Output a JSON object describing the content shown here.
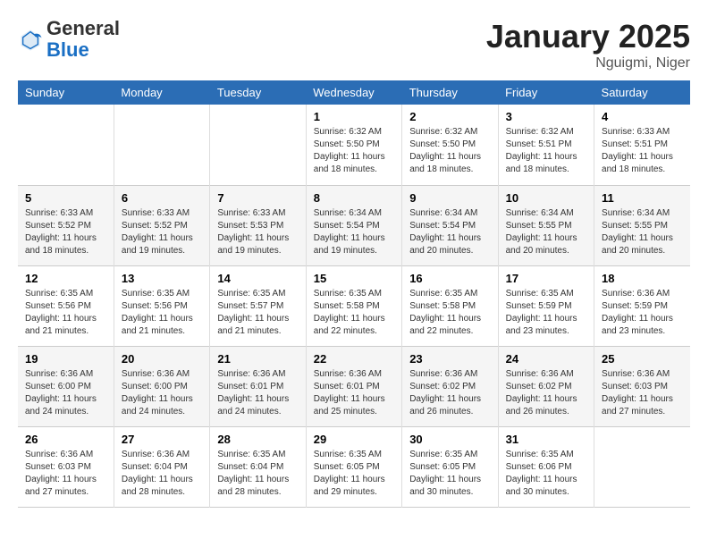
{
  "header": {
    "logo_general": "General",
    "logo_blue": "Blue",
    "month_year": "January 2025",
    "location": "Nguigmi, Niger"
  },
  "days_of_week": [
    "Sunday",
    "Monday",
    "Tuesday",
    "Wednesday",
    "Thursday",
    "Friday",
    "Saturday"
  ],
  "weeks": [
    [
      {
        "day": "",
        "info": ""
      },
      {
        "day": "",
        "info": ""
      },
      {
        "day": "",
        "info": ""
      },
      {
        "day": "1",
        "info": "Sunrise: 6:32 AM\nSunset: 5:50 PM\nDaylight: 11 hours\nand 18 minutes."
      },
      {
        "day": "2",
        "info": "Sunrise: 6:32 AM\nSunset: 5:50 PM\nDaylight: 11 hours\nand 18 minutes."
      },
      {
        "day": "3",
        "info": "Sunrise: 6:32 AM\nSunset: 5:51 PM\nDaylight: 11 hours\nand 18 minutes."
      },
      {
        "day": "4",
        "info": "Sunrise: 6:33 AM\nSunset: 5:51 PM\nDaylight: 11 hours\nand 18 minutes."
      }
    ],
    [
      {
        "day": "5",
        "info": "Sunrise: 6:33 AM\nSunset: 5:52 PM\nDaylight: 11 hours\nand 18 minutes."
      },
      {
        "day": "6",
        "info": "Sunrise: 6:33 AM\nSunset: 5:52 PM\nDaylight: 11 hours\nand 19 minutes."
      },
      {
        "day": "7",
        "info": "Sunrise: 6:33 AM\nSunset: 5:53 PM\nDaylight: 11 hours\nand 19 minutes."
      },
      {
        "day": "8",
        "info": "Sunrise: 6:34 AM\nSunset: 5:54 PM\nDaylight: 11 hours\nand 19 minutes."
      },
      {
        "day": "9",
        "info": "Sunrise: 6:34 AM\nSunset: 5:54 PM\nDaylight: 11 hours\nand 20 minutes."
      },
      {
        "day": "10",
        "info": "Sunrise: 6:34 AM\nSunset: 5:55 PM\nDaylight: 11 hours\nand 20 minutes."
      },
      {
        "day": "11",
        "info": "Sunrise: 6:34 AM\nSunset: 5:55 PM\nDaylight: 11 hours\nand 20 minutes."
      }
    ],
    [
      {
        "day": "12",
        "info": "Sunrise: 6:35 AM\nSunset: 5:56 PM\nDaylight: 11 hours\nand 21 minutes."
      },
      {
        "day": "13",
        "info": "Sunrise: 6:35 AM\nSunset: 5:56 PM\nDaylight: 11 hours\nand 21 minutes."
      },
      {
        "day": "14",
        "info": "Sunrise: 6:35 AM\nSunset: 5:57 PM\nDaylight: 11 hours\nand 21 minutes."
      },
      {
        "day": "15",
        "info": "Sunrise: 6:35 AM\nSunset: 5:58 PM\nDaylight: 11 hours\nand 22 minutes."
      },
      {
        "day": "16",
        "info": "Sunrise: 6:35 AM\nSunset: 5:58 PM\nDaylight: 11 hours\nand 22 minutes."
      },
      {
        "day": "17",
        "info": "Sunrise: 6:35 AM\nSunset: 5:59 PM\nDaylight: 11 hours\nand 23 minutes."
      },
      {
        "day": "18",
        "info": "Sunrise: 6:36 AM\nSunset: 5:59 PM\nDaylight: 11 hours\nand 23 minutes."
      }
    ],
    [
      {
        "day": "19",
        "info": "Sunrise: 6:36 AM\nSunset: 6:00 PM\nDaylight: 11 hours\nand 24 minutes."
      },
      {
        "day": "20",
        "info": "Sunrise: 6:36 AM\nSunset: 6:00 PM\nDaylight: 11 hours\nand 24 minutes."
      },
      {
        "day": "21",
        "info": "Sunrise: 6:36 AM\nSunset: 6:01 PM\nDaylight: 11 hours\nand 24 minutes."
      },
      {
        "day": "22",
        "info": "Sunrise: 6:36 AM\nSunset: 6:01 PM\nDaylight: 11 hours\nand 25 minutes."
      },
      {
        "day": "23",
        "info": "Sunrise: 6:36 AM\nSunset: 6:02 PM\nDaylight: 11 hours\nand 26 minutes."
      },
      {
        "day": "24",
        "info": "Sunrise: 6:36 AM\nSunset: 6:02 PM\nDaylight: 11 hours\nand 26 minutes."
      },
      {
        "day": "25",
        "info": "Sunrise: 6:36 AM\nSunset: 6:03 PM\nDaylight: 11 hours\nand 27 minutes."
      }
    ],
    [
      {
        "day": "26",
        "info": "Sunrise: 6:36 AM\nSunset: 6:03 PM\nDaylight: 11 hours\nand 27 minutes."
      },
      {
        "day": "27",
        "info": "Sunrise: 6:36 AM\nSunset: 6:04 PM\nDaylight: 11 hours\nand 28 minutes."
      },
      {
        "day": "28",
        "info": "Sunrise: 6:35 AM\nSunset: 6:04 PM\nDaylight: 11 hours\nand 28 minutes."
      },
      {
        "day": "29",
        "info": "Sunrise: 6:35 AM\nSunset: 6:05 PM\nDaylight: 11 hours\nand 29 minutes."
      },
      {
        "day": "30",
        "info": "Sunrise: 6:35 AM\nSunset: 6:05 PM\nDaylight: 11 hours\nand 30 minutes."
      },
      {
        "day": "31",
        "info": "Sunrise: 6:35 AM\nSunset: 6:06 PM\nDaylight: 11 hours\nand 30 minutes."
      },
      {
        "day": "",
        "info": ""
      }
    ]
  ],
  "colors": {
    "header_bg": "#2b6db5",
    "header_text": "#ffffff",
    "accent": "#1a6fc4"
  }
}
